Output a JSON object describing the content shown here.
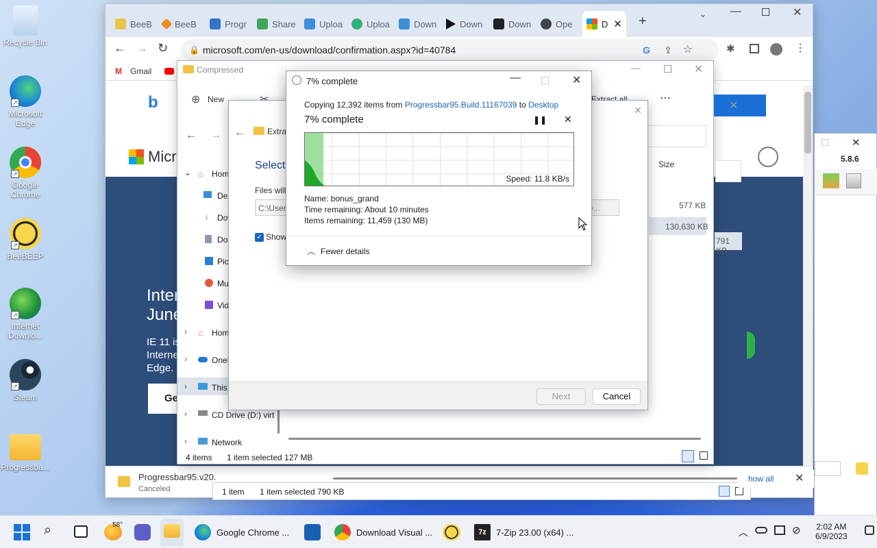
{
  "desktop": {
    "icons": [
      {
        "label": "Recycle Bin"
      },
      {
        "label": "Microsoft Edge"
      },
      {
        "label": "Google Chrome"
      },
      {
        "label": "BeeBEEP"
      },
      {
        "label": "Internet Downlo..."
      },
      {
        "label": "Steam"
      },
      {
        "label": "Progressba..."
      }
    ]
  },
  "chrome": {
    "tabs": [
      {
        "label": "BeeB",
        "icon": "beebeep-icon"
      },
      {
        "label": "BeeB",
        "icon": "beebeep-icon"
      },
      {
        "label": "Progr",
        "icon": "progressbar-icon"
      },
      {
        "label": "Share",
        "icon": "share-icon"
      },
      {
        "label": "Uploa",
        "icon": "upload-icon"
      },
      {
        "label": "Uploa",
        "icon": "upload-icon"
      },
      {
        "label": "Down",
        "icon": "download-icon"
      },
      {
        "label": "Down",
        "icon": "play-icon"
      },
      {
        "label": "Down",
        "icon": "7zip-icon"
      },
      {
        "label": "Ope",
        "icon": "github-icon"
      },
      {
        "label": "D",
        "icon": "microsoft-icon"
      }
    ],
    "url": "microsoft.com/en-us/download/confirmation.aspx?id=40784",
    "bookmarks": [
      {
        "label": "Gmail"
      }
    ],
    "page": {
      "brand": "Micr",
      "headline_1": "Inter",
      "headline_2": "June",
      "body_1": "IE 11 is",
      "body_2": "Interne",
      "body_3": "Edge.",
      "button": "Ge"
    },
    "download": {
      "name": "Progressbar95.v20.",
      "status": "Canceled"
    },
    "lower_status": {
      "items": "1 item",
      "selected": "1 item selected  790 KB"
    }
  },
  "explorer": {
    "title": "Compressed",
    "toolbar": {
      "new": "New",
      "extract_all": "Extract all"
    },
    "nav": [
      {
        "label": "Hom"
      },
      {
        "label": "Des"
      },
      {
        "label": "Dow"
      },
      {
        "label": "Doc"
      },
      {
        "label": "Pic"
      },
      {
        "label": "Mu"
      },
      {
        "label": "Vid"
      },
      {
        "label": "Hom"
      },
      {
        "label": "OneI"
      },
      {
        "label": "This"
      },
      {
        "label": "CD Drive (D:) virt"
      },
      {
        "label": "Network"
      }
    ],
    "column_size": "Size",
    "sizes": [
      "577 KB",
      "130,630 KB",
      "791 KB"
    ],
    "browse": "se...",
    "status": {
      "items": "4 items",
      "selected": "1 item selected  127 MB"
    }
  },
  "wizard": {
    "title": "Extra",
    "heading": "Select",
    "files_will": "Files will",
    "path": "C:\\User",
    "show": "Show",
    "next": "Next",
    "cancel": "Cancel"
  },
  "progress": {
    "title": "7% complete",
    "copy_prefix": "Copying 12,392 items from",
    "source": "Progressbar95.Build.11167039",
    "to": "to",
    "dest": "Desktop",
    "percent_text": "7% complete",
    "percent": 7,
    "speed": "Speed: 11.8 KB/s",
    "name": "Name:  bonus_grand",
    "time": "Time remaining:  About 10 minutes",
    "items": "Items remaining:  11,459 (130 MB)",
    "fewer": "Fewer details"
  },
  "zip": {
    "version": "5.8.6"
  },
  "taskbar": {
    "weather": "58°",
    "items": [
      {
        "label": "Google Chrome ..."
      },
      {
        "label": "Download Visual ..."
      },
      {
        "label": "7-Zip 23.00 (x64) ..."
      }
    ],
    "time": "2:02 AM",
    "date": "6/9/2023"
  }
}
